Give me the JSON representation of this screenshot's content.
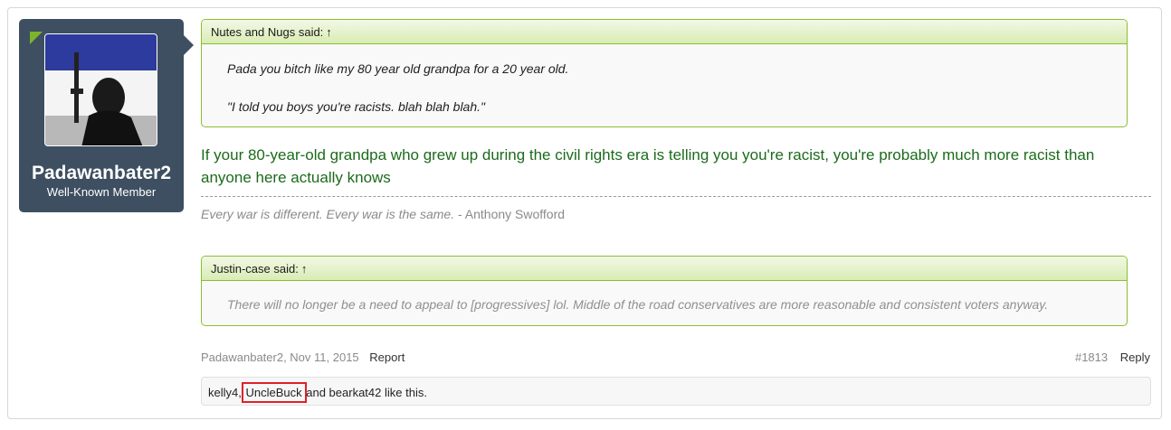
{
  "user": {
    "name": "Padawanbater2",
    "title": "Well-Known Member"
  },
  "quote1": {
    "attribution": "Nutes and Nugs said:",
    "arrow": "↑",
    "lines": [
      "Pada you bitch like my 80 year old grandpa for a 20 year old.",
      "\"I told you boys you're racists. blah blah blah.\""
    ]
  },
  "message": "If your 80-year-old grandpa who grew up during the civil rights era is telling you you're racist, you're probably much more racist than anyone here actually knows",
  "signature": {
    "quote": "Every war is different. Every war is the same.",
    "author": "- Anthony Swofford"
  },
  "quote2": {
    "attribution": "Justin-case said:",
    "arrow": "↑",
    "text": "There will no longer be a need to appeal to [progressives] lol. Middle of the road conservatives are more reasonable and consistent voters anyway."
  },
  "meta": {
    "author_date": "Padawanbater2, Nov 11, 2015",
    "report": "Report",
    "post_number": "#1813",
    "reply": "Reply"
  },
  "likes": {
    "user1": "kelly4",
    "sep": ",",
    "user2": "UncleBuck",
    "rest": " and bearkat42 like this."
  },
  "colors": {
    "card_bg": "#3d4f60",
    "quote_border": "#8bbf2f",
    "message_text": "#1b6b1b",
    "highlight": "#e0202a"
  }
}
